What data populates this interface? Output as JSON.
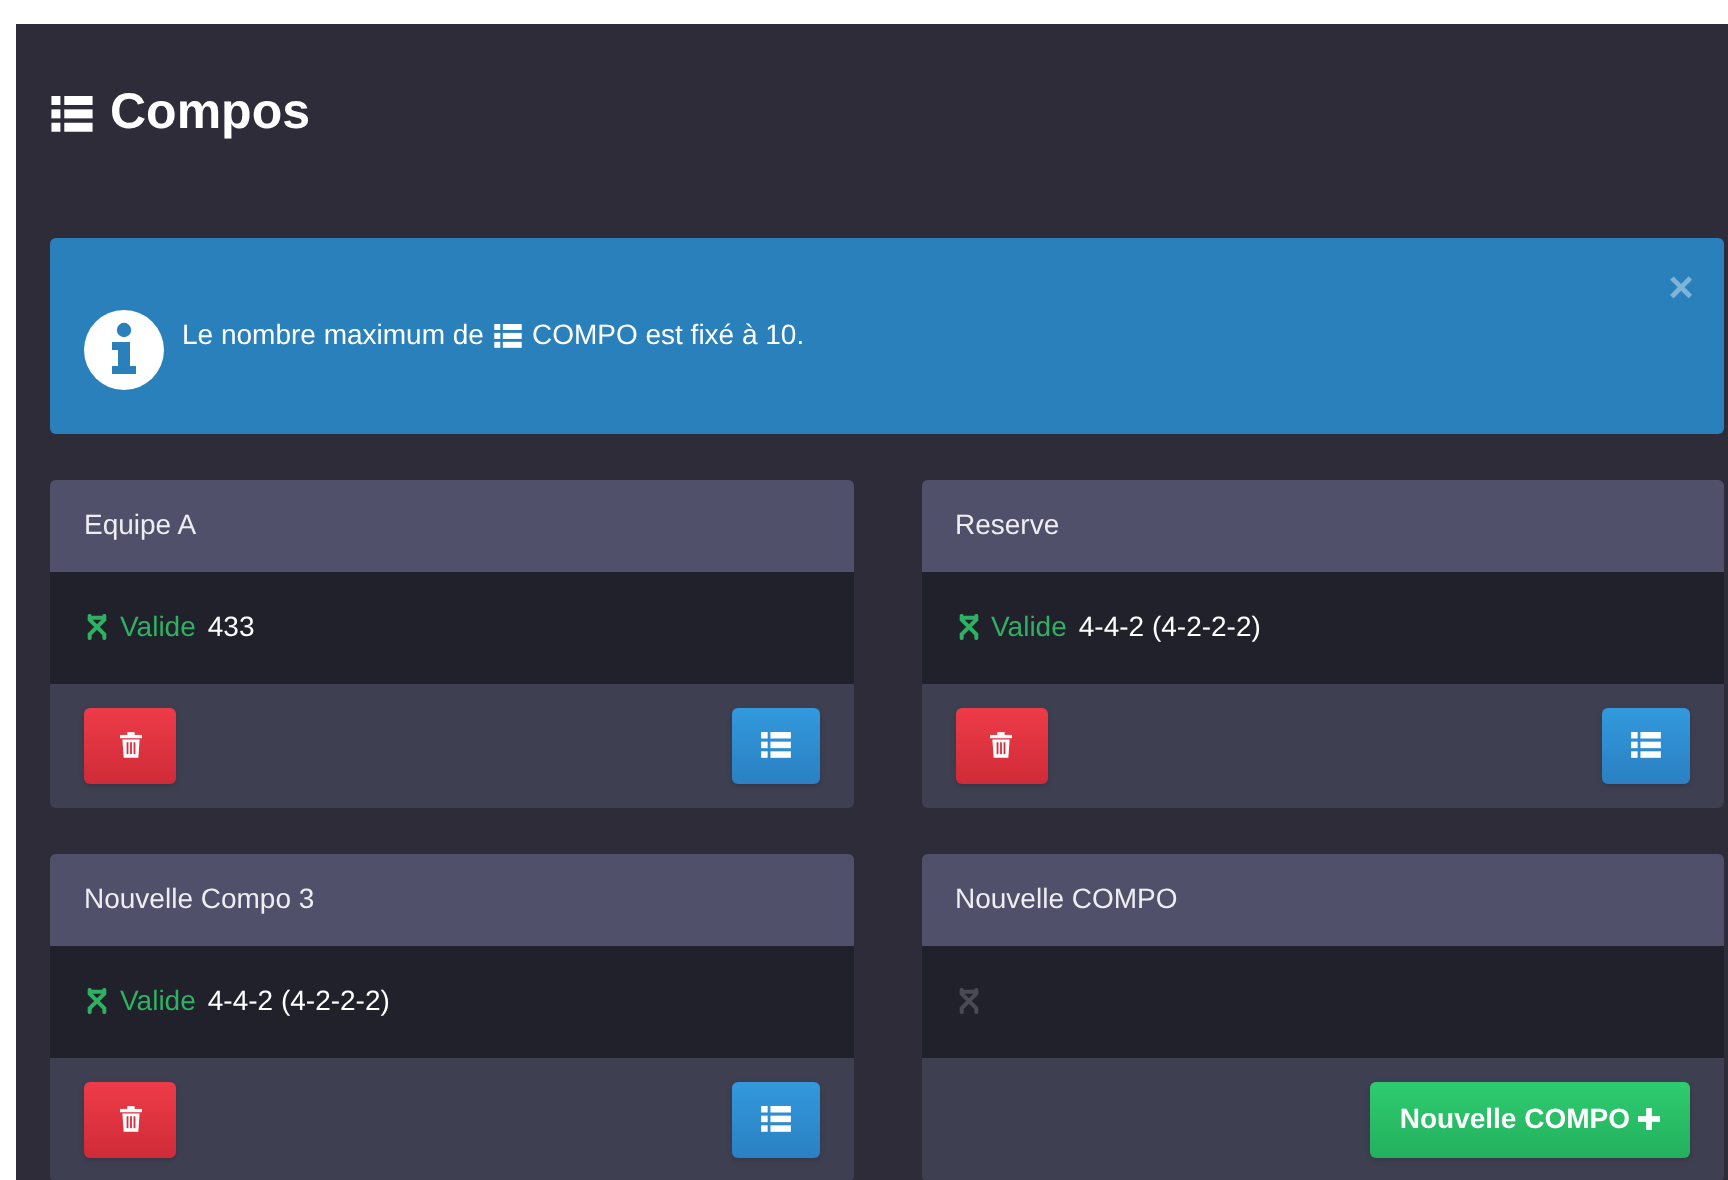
{
  "title": "Compos",
  "alert": {
    "text_before": "Le nombre maximum de",
    "text_after": "COMPO est fixé à 10.",
    "close": "×"
  },
  "cards": [
    {
      "kind": "compo",
      "name": "Equipe A",
      "valid": true,
      "status": "Valide",
      "formation": "433"
    },
    {
      "kind": "compo",
      "name": "Reserve",
      "valid": true,
      "status": "Valide",
      "formation": "4-4-2 (4-2-2-2)"
    },
    {
      "kind": "compo",
      "name": "Nouvelle Compo 3",
      "valid": true,
      "status": "Valide",
      "formation": "4-4-2 (4-2-2-2)"
    },
    {
      "kind": "new",
      "name": "Nouvelle COMPO",
      "valid": false,
      "button": "Nouvelle COMPO"
    }
  ]
}
